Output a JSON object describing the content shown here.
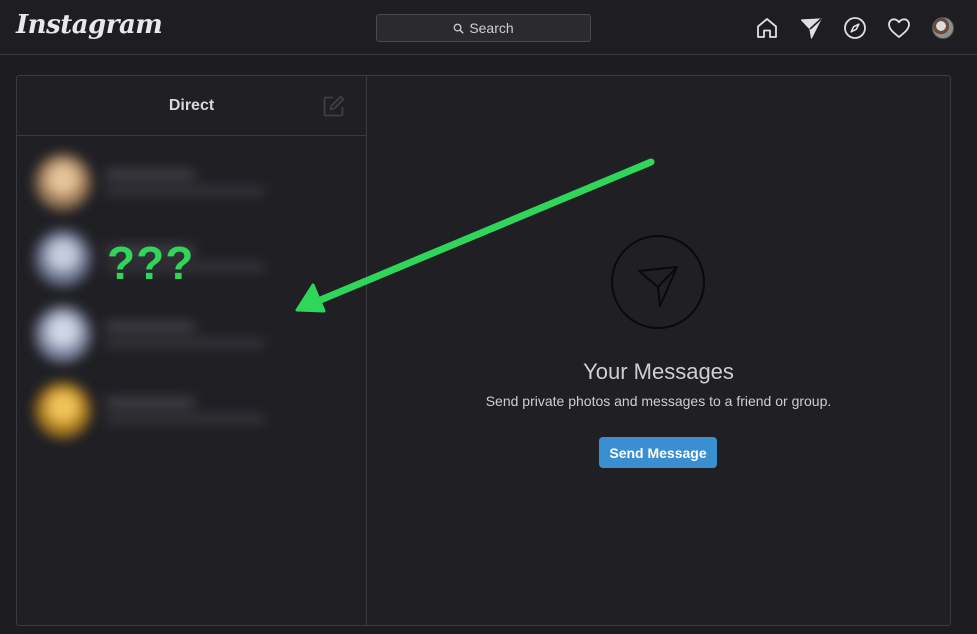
{
  "header": {
    "brand": "Instagram",
    "search_placeholder": "Search",
    "icons": [
      "home-icon",
      "direct-icon",
      "explore-icon",
      "activity-heart-icon",
      "profile-avatar"
    ]
  },
  "direct": {
    "title": "Direct",
    "compose_icon": "compose-icon",
    "conversations": [
      {
        "avatar_color": "#c8a27a"
      },
      {
        "avatar_color": "#8c96b2"
      },
      {
        "avatar_color": "#a8b0c4"
      },
      {
        "avatar_color": "#d4a640"
      }
    ]
  },
  "annotation": {
    "text": "???",
    "color": "#2fd659"
  },
  "empty_state": {
    "icon": "paper-plane-circle-icon",
    "title": "Your Messages",
    "subtitle": "Send private photos and messages to a friend or group.",
    "button": "Send Message"
  },
  "colors": {
    "background": "#1c1c21",
    "accent_button": "#3a8fd0",
    "annotation_arrow": "#2fd659"
  }
}
